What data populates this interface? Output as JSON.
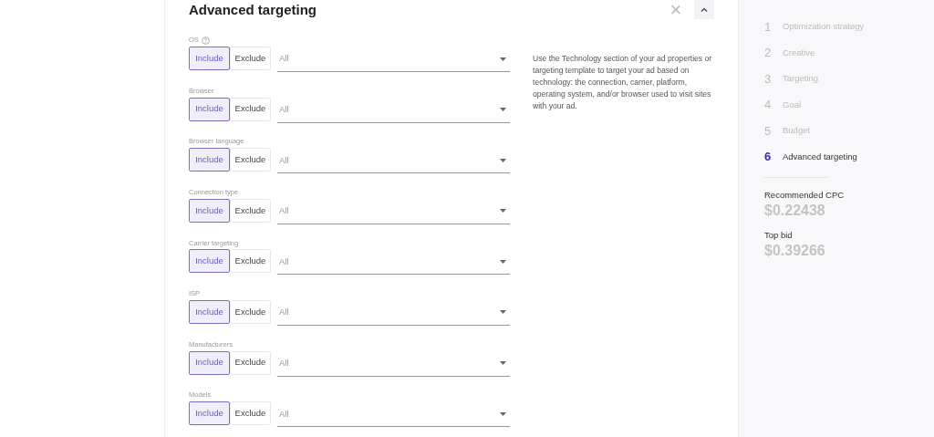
{
  "panel": {
    "title": "Advanced targeting",
    "close_label": "×"
  },
  "filters": [
    {
      "label": "OS",
      "help": true,
      "include": "Include",
      "exclude": "Exclude",
      "mode_include": true,
      "value": "All"
    },
    {
      "label": "Browser",
      "help": false,
      "include": "Include",
      "exclude": "Exclude",
      "mode_include": true,
      "value": "All"
    },
    {
      "label": "Browser language",
      "help": false,
      "include": "Include",
      "exclude": "Exclude",
      "mode_include": true,
      "value": "All"
    },
    {
      "label": "Connection type",
      "help": false,
      "include": "Include",
      "exclude": "Exclude",
      "mode_include": true,
      "value": "All"
    },
    {
      "label": "Carrier targeting",
      "help": false,
      "include": "Include",
      "exclude": "Exclude",
      "mode_include": true,
      "value": "All"
    },
    {
      "label": "ISP",
      "help": false,
      "include": "Include",
      "exclude": "Exclude",
      "mode_include": true,
      "value": "All"
    },
    {
      "label": "Manufacturers",
      "help": false,
      "include": "Include",
      "exclude": "Exclude",
      "mode_include": true,
      "value": "All"
    },
    {
      "label": "Models",
      "help": false,
      "include": "Include",
      "exclude": "Exclude",
      "mode_include": true,
      "value": "All"
    }
  ],
  "description": "Use the Technology section of your ad properties or targeting template to target your ad based on technology: the connection, carrier, platform, operating system, and/or browser used to visit sites with your ad.",
  "steps": [
    {
      "number": "1",
      "label": "Optimization strategy",
      "selected": false
    },
    {
      "number": "2",
      "label": "Creative",
      "selected": false
    },
    {
      "number": "3",
      "label": "Targeting",
      "selected": false
    },
    {
      "number": "4",
      "label": "Goal",
      "selected": false
    },
    {
      "number": "5",
      "label": "Budget",
      "selected": false
    },
    {
      "number": "6",
      "label": "Advanced targeting",
      "selected": true
    }
  ],
  "stats": [
    {
      "label": "Recommended CPC",
      "value": "$0.22438"
    },
    {
      "label": "Top bid",
      "value": "$0.39266"
    }
  ]
}
